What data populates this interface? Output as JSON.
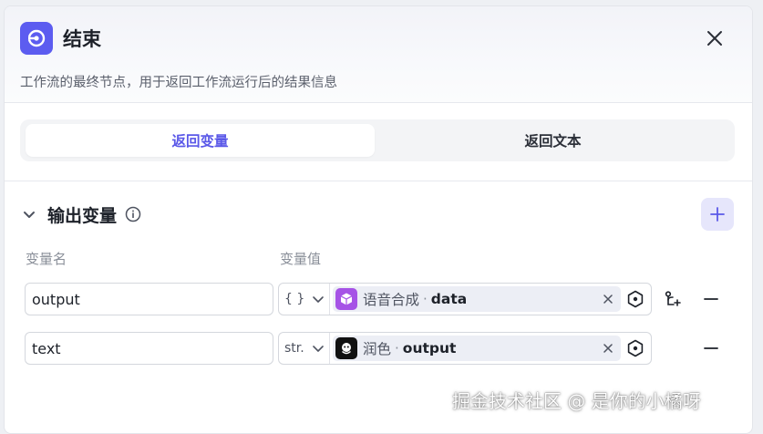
{
  "node": {
    "title": "结束",
    "description": "工作流的最终节点，用于返回工作流运行后的结果信息",
    "icon": "stop-circle-icon",
    "accent": "#5c5cf0"
  },
  "mode_tabs": [
    {
      "label": "返回变量",
      "active": true
    },
    {
      "label": "返回文本",
      "active": false
    }
  ],
  "output_section": {
    "title": "输出变量",
    "columns": {
      "name": "变量名",
      "value": "变量值"
    },
    "rows": [
      {
        "name": "output",
        "type": "{ }",
        "source_node": "语音合成",
        "separator": "·",
        "field": "data",
        "source_icon": "cube-icon",
        "source_color": "#a653e6"
      },
      {
        "name": "text",
        "type": "str.",
        "source_node": "润色",
        "separator": "·",
        "field": "output",
        "source_icon": "llm-icon",
        "source_color": "#111111"
      }
    ]
  },
  "watermark": "掘金技术社区 @ 是你的小橘呀"
}
